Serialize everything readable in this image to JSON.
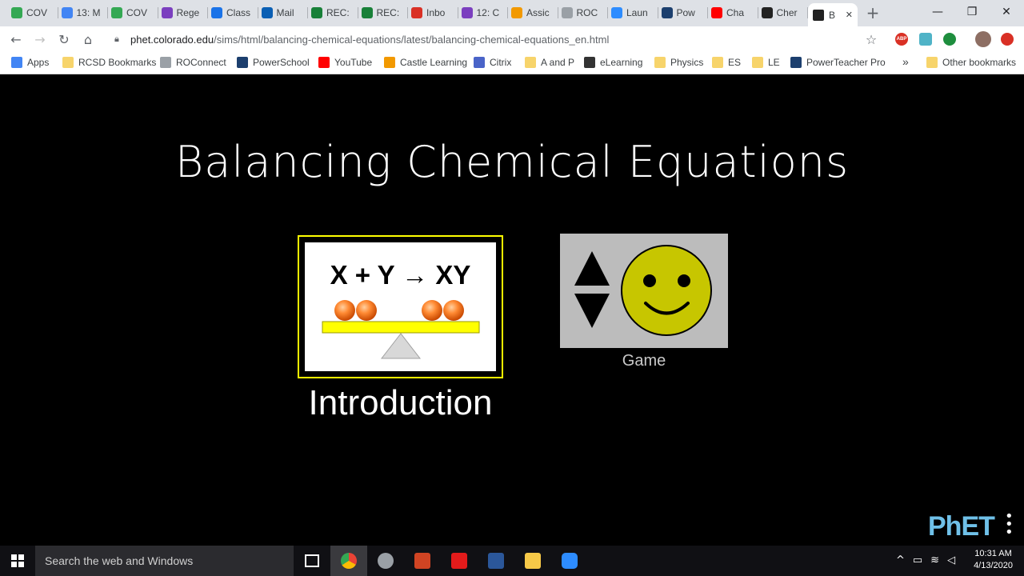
{
  "tabs": [
    {
      "label": "COV",
      "color": "#34a853"
    },
    {
      "label": "13: M",
      "color": "#4285f4"
    },
    {
      "label": "COV",
      "color": "#34a853"
    },
    {
      "label": "Rege",
      "color": "#7b3fbf"
    },
    {
      "label": "Class",
      "color": "#1a73e8"
    },
    {
      "label": "Mail",
      "color": "#0a5fb4"
    },
    {
      "label": "REC:",
      "color": "#188038"
    },
    {
      "label": "REC:",
      "color": "#188038"
    },
    {
      "label": "Inbo",
      "color": "#d93025"
    },
    {
      "label": "12: C",
      "color": "#7b3fbf"
    },
    {
      "label": "Assic",
      "color": "#f29900"
    },
    {
      "label": "ROC",
      "color": "#9aa0a6"
    },
    {
      "label": "Laun",
      "color": "#2d8cff"
    },
    {
      "label": "Pow",
      "color": "#1c3f6e"
    },
    {
      "label": "Cha",
      "color": "#ff0000"
    },
    {
      "label": "Cher",
      "color": "#222222"
    }
  ],
  "active_tab": {
    "label": "B"
  },
  "window_controls": {
    "minimize": "—",
    "restore": "❐",
    "close": "✕"
  },
  "toolbar": {
    "url_host": "phet.colorado.edu",
    "url_path": "/sims/html/balancing-chemical-equations/latest/balancing-chemical-equations_en.html",
    "ext_abp": "ABP"
  },
  "bookmarks": [
    {
      "label": "Apps",
      "color": "#4285f4"
    },
    {
      "label": "RCSD Bookmarks",
      "color": "#f7d46b"
    },
    {
      "label": "ROConnect",
      "color": "#9aa0a6"
    },
    {
      "label": "PowerSchool",
      "color": "#1c3f6e"
    },
    {
      "label": "YouTube",
      "color": "#ff0000"
    },
    {
      "label": "Castle Learning",
      "color": "#f29900"
    },
    {
      "label": "Citrix",
      "color": "#4a64c8"
    },
    {
      "label": "A and P",
      "color": "#f7d46b"
    },
    {
      "label": "eLearning",
      "color": "#333333"
    },
    {
      "label": "Physics",
      "color": "#f7d46b"
    },
    {
      "label": "ES",
      "color": "#f7d46b"
    },
    {
      "label": "LE",
      "color": "#f7d46b"
    },
    {
      "label": "PowerTeacher Pro",
      "color": "#1c3f6e"
    }
  ],
  "bookmarks_overflow": "»",
  "other_bookmarks": "Other bookmarks",
  "sim": {
    "title": "Balancing Chemical Equations",
    "intro_equation": "X + Y → XY",
    "intro_label": "Introduction",
    "game_label": "Game",
    "logo_text": "PhET"
  },
  "taskbar": {
    "search_placeholder": "Search the web and Windows",
    "time": "10:31 AM",
    "date": "4/13/2020"
  }
}
